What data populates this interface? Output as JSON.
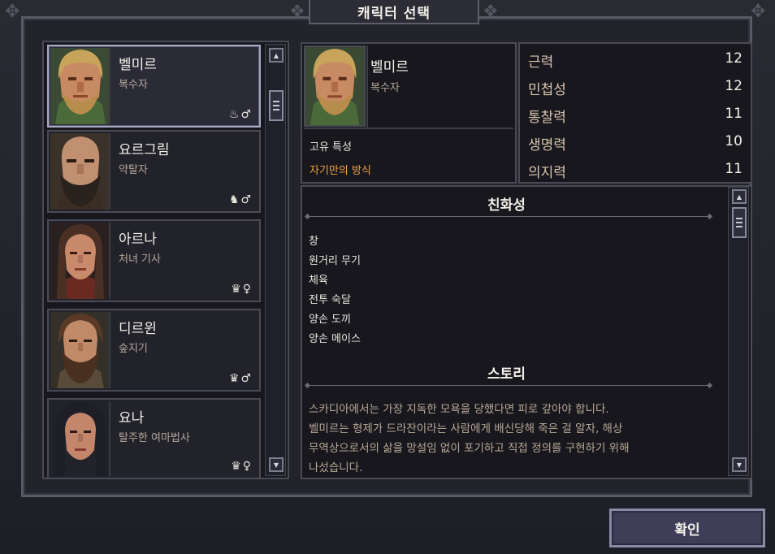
{
  "window": {
    "title": "캐릭터 선택"
  },
  "characters": [
    {
      "name": "벨미르",
      "class": "복수자",
      "icons": "♨♂",
      "selected": true
    },
    {
      "name": "요르그림",
      "class": "약탈자",
      "icons": "♞♂",
      "selected": false
    },
    {
      "name": "아르나",
      "class": "처녀 기사",
      "icons": "♛♀",
      "selected": false
    },
    {
      "name": "디르윈",
      "class": "숲지기",
      "icons": "♛♂",
      "selected": false
    },
    {
      "name": "요나",
      "class": "탈주한 여마법사",
      "icons": "♛♀",
      "selected": false
    }
  ],
  "selected": {
    "name": "벨미르",
    "class": "복수자",
    "trait_label": "고유 특성",
    "trait_value": "자기만의 방식"
  },
  "stats": [
    {
      "label": "근력",
      "value": "12"
    },
    {
      "label": "민첩성",
      "value": "12"
    },
    {
      "label": "통찰력",
      "value": "11"
    },
    {
      "label": "생명력",
      "value": "10"
    },
    {
      "label": "의지력",
      "value": "11"
    }
  ],
  "affinity": {
    "title": "친화성",
    "items": [
      "창",
      "원거리 무기",
      "체육",
      "전투 숙달",
      "양손 도끼",
      "양손 메이스"
    ]
  },
  "story": {
    "title": "스토리",
    "lines": [
      "스카디아에서는 가장 지독한 모욕을 당했다면 피로 갚아야 합니다.",
      "벨미르는 형제가 드라잔이라는 사람에게 배신당해 죽은 걸 알자, 해상",
      "무역상으로서의 삶을 망설임 없이 포기하고 직접 정의를 구현하기 위해",
      "나섰습니다."
    ]
  },
  "confirm_label": "확인",
  "colors": {
    "trait": "#f0a24a",
    "stat_label": "#d8c4ae",
    "panel": "#17171d"
  }
}
